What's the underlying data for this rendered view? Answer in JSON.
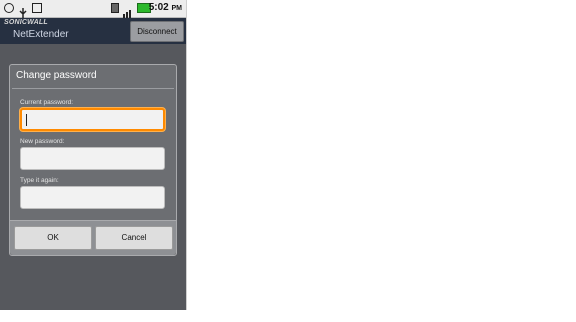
{
  "statusbar": {
    "icons": [
      "android-icon",
      "usb-icon",
      "notification-icon",
      "sim-icon",
      "signal-icon",
      "battery-icon"
    ],
    "time": "5:02",
    "ampm": "PM"
  },
  "appbar": {
    "brand": "SONICWALL",
    "title": "NetExtender",
    "disconnect_label": "Disconnect"
  },
  "dialog": {
    "title": "Change password",
    "current_label": "Current password:",
    "new_label": "New password:",
    "confirm_label": "Type it again:",
    "current_value": "",
    "new_value": "",
    "confirm_value": "",
    "ok_label": "OK",
    "cancel_label": "Cancel"
  },
  "colors": {
    "focus": "#ff8a00",
    "appbar": "#263041",
    "battery": "#2bb82b"
  }
}
